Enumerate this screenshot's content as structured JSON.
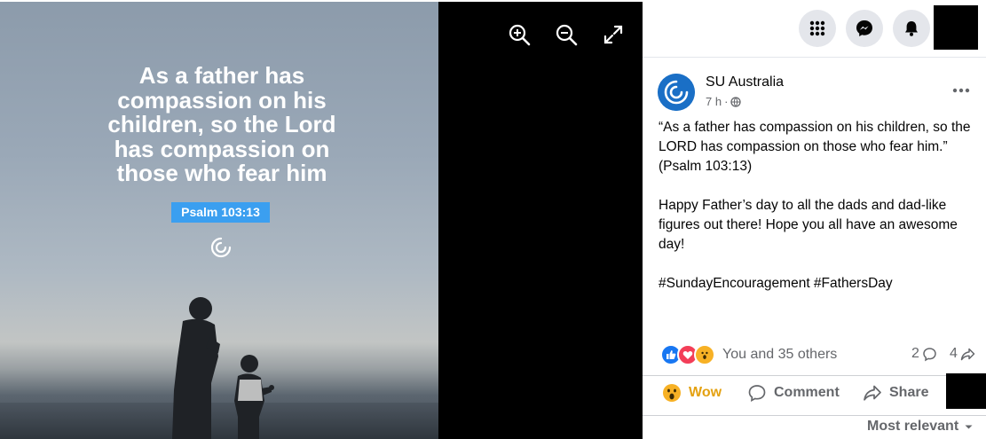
{
  "photo": {
    "quote_lines": [
      "As a father has",
      "compassion on his",
      "children, so the Lord",
      "has compassion on",
      "those who fear him"
    ],
    "reference": "Psalm 103:13"
  },
  "viewer_tools": [
    {
      "name": "zoom-in-icon"
    },
    {
      "name": "zoom-out-icon"
    },
    {
      "name": "fullscreen-icon"
    }
  ],
  "topbar": {
    "icons": [
      "menu-grid-icon",
      "messenger-icon",
      "notifications-icon"
    ]
  },
  "post": {
    "author": "SU Australia",
    "time": "7 h",
    "separator": "·",
    "body_lines": [
      "“As a father has compassion on his children, so the LORD has compassion on those who fear him.”",
      "(Psalm 103:13)",
      "",
      "Happy Father’s day to all the dads and dad-like figures out there! Hope you all have an awesome day!",
      "",
      "#SundayEncouragement #FathersDay"
    ]
  },
  "reactions": {
    "icons": [
      "like",
      "love",
      "wow"
    ],
    "summary": "You and 35 others",
    "comments_count": "2",
    "shares_count": "4"
  },
  "actions": {
    "wow": "Wow",
    "comment": "Comment",
    "share": "Share"
  },
  "comments_sort": "Most relevant",
  "colors": {
    "wow_accent": "#e4a110",
    "like_blue": "#1877f2",
    "love_red": "#f33e58",
    "tag_blue": "#3b9ff0"
  }
}
